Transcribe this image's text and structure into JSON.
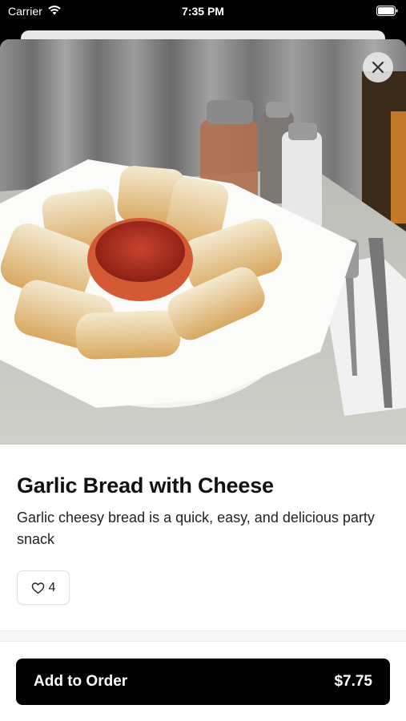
{
  "status_bar": {
    "carrier": "Carrier",
    "time": "7:35 PM",
    "icons": [
      "wifi-icon",
      "battery-icon"
    ]
  },
  "item": {
    "title": "Garlic Bread with Cheese",
    "description": "Garlic cheesy bread is a quick, easy, and delicious party snack",
    "likes": "4",
    "image": "photo of garlic cheese bread sticks on a plate with marinara dipping sauce, salt and pepper shakers, fork and knife"
  },
  "close_icon": "close-icon",
  "like_icon": "heart-outline-icon",
  "order_button": {
    "label": "Add to Order",
    "price": "$7.75"
  },
  "colors": {
    "button_bg": "#000000",
    "button_text": "#ffffff",
    "sheet_bg": "#ffffff"
  }
}
